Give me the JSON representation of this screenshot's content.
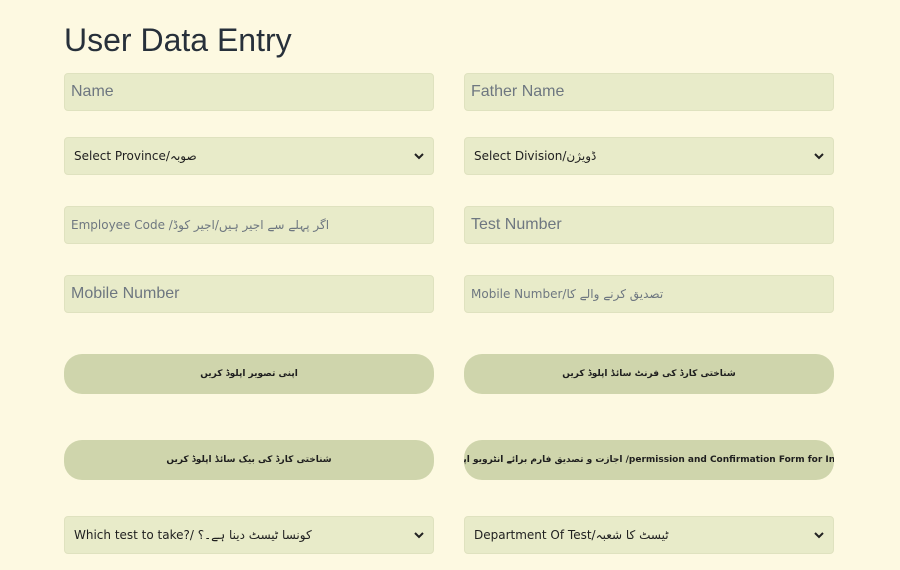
{
  "page": {
    "title": "User Data Entry"
  },
  "form": {
    "name_placeholder": "Name",
    "father_name_placeholder": "Father Name",
    "province_select": "Select Province/صوبہ",
    "division_select": "Select Division/ڈویژن",
    "employee_code_placeholder": "Employee Code /اگر پہلے سے اجیر ہیں/اجیر کوڈ",
    "test_number_placeholder": "Test Number",
    "mobile_number_placeholder": "Mobile Number",
    "verifier_mobile_placeholder": "Mobile Number/تصدیق کرنے والے کا",
    "upload_photo_label": "اپنی تصویر اپلوڈ کریں",
    "upload_cnic_front_label": "شناختی کارڈ کی فرنٹ سائڈ اپلوڈ کریں",
    "upload_cnic_back_label": "شناختی کارڈ کی بیک سائڈ اپلوڈ کریں",
    "upload_permission_form_label": "اجازت و تصدیق فارم برائے انٹرویو اپلوڈ کریں /permission and Confirmation Form for Interview",
    "test_select": "Which test to take?/ کونسا ٹیسٹ دینا ہے۔؟",
    "department_select": "Department Of Test/ٹیسٹ کا شعبہ"
  },
  "icons": {
    "dropdown": "chevron-down-icon"
  },
  "colors": {
    "background": "#fdf9e1",
    "field": "#e8ebc9",
    "button": "#cfd5ac",
    "title": "#27303a"
  }
}
